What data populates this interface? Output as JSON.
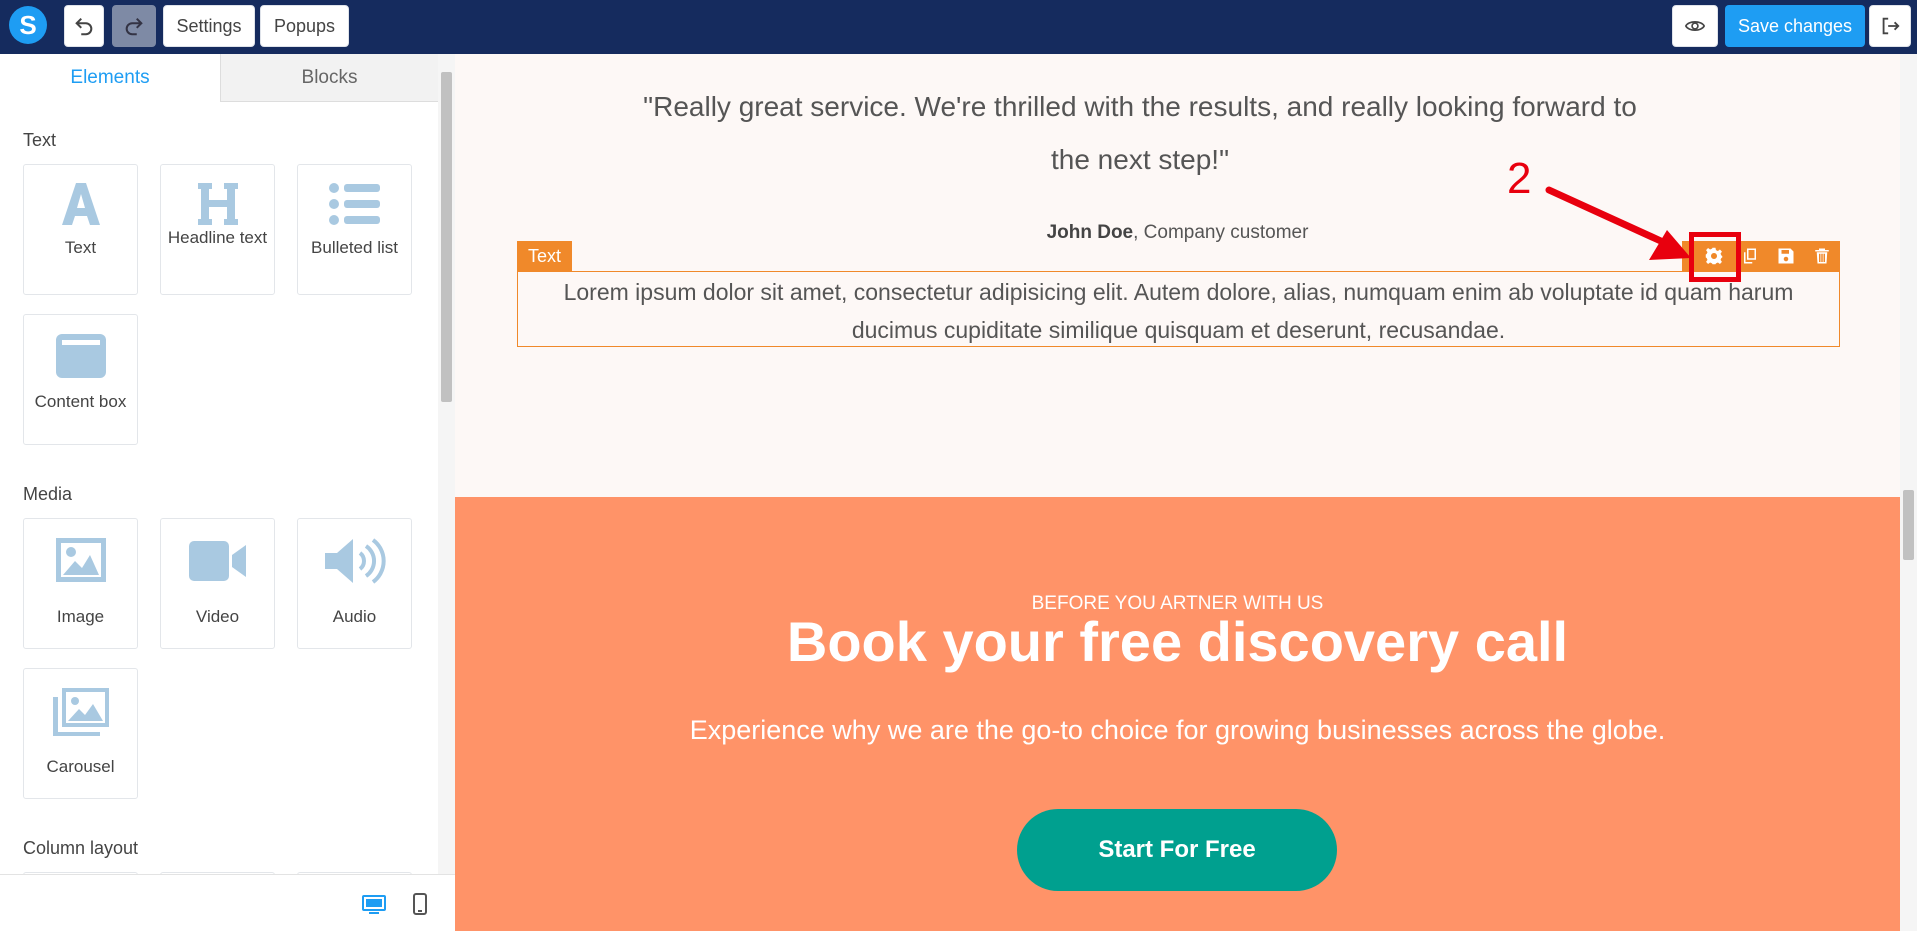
{
  "topbar": {
    "logo_letter": "S",
    "settings_label": "Settings",
    "popups_label": "Popups",
    "save_label": "Save changes"
  },
  "panel": {
    "tabs": [
      {
        "label": "Elements"
      },
      {
        "label": "Blocks"
      }
    ],
    "sections": [
      {
        "label": "Text"
      },
      {
        "label": "Media"
      },
      {
        "label": "Column layout"
      }
    ],
    "items": {
      "text": "Text",
      "headline": "Headline text",
      "bulleted": "Bulleted list",
      "content_box": "Content box",
      "image": "Image",
      "video": "Video",
      "audio": "Audio",
      "carousel": "Carousel"
    }
  },
  "canvas": {
    "quote": "\"Really great service. We're thrilled with the results, and really looking forward to the next step!\"",
    "author_name": "John Doe",
    "author_role": ", Company customer",
    "selected_tag": "Text",
    "lorem": "Lorem ipsum dolor sit amet, consectetur adipisicing elit. Autem dolore, alias, numquam enim ab voluptate id quam harum ducimus cupiditate similique quisquam et deserunt, recusandae.",
    "annotation_number": "2",
    "eyebrow": "BEFORE YOU ARTNER WITH US",
    "headline": "Book your free discovery call",
    "subline": "Experience why we are the go-to choice for growing businesses across the globe.",
    "cta_label": "Start For Free"
  },
  "colors": {
    "topbar": "#152b5e",
    "accent": "#1e9df3",
    "selection": "#f0892a",
    "annotation": "#e8000e",
    "cta_section": "#ff9368",
    "cta_button": "#00a08f"
  }
}
